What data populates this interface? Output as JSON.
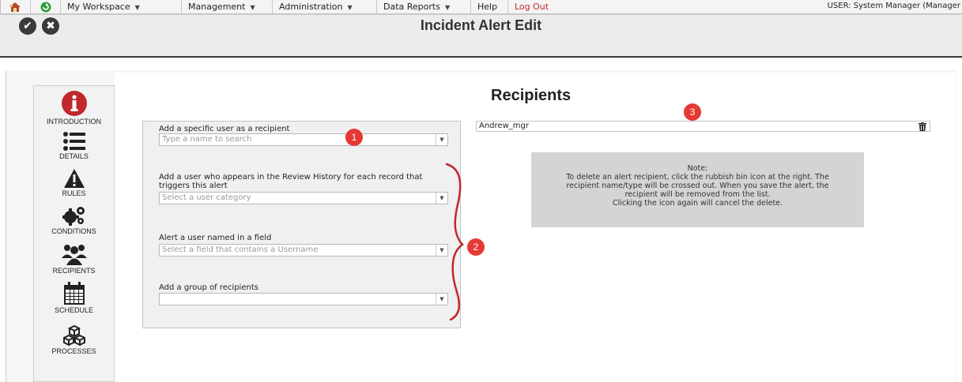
{
  "nav": {
    "items": [
      {
        "label": "My Workspace",
        "dropdown": true
      },
      {
        "label": "Management",
        "dropdown": true
      },
      {
        "label": "Administration",
        "dropdown": true
      },
      {
        "label": "Data Reports",
        "dropdown": true
      },
      {
        "label": "Help",
        "dropdown": false
      },
      {
        "label": "Log Out",
        "dropdown": false
      }
    ],
    "icons": [
      "home-icon",
      "refresh-icon"
    ],
    "caret": "▼",
    "user": "USER: System Manager (Manager"
  },
  "toolbar": {
    "title": "Incident Alert Edit",
    "save_icon": "✔",
    "cancel_icon": "✖"
  },
  "sidebar": {
    "items": [
      {
        "label": "INTRODUCTION",
        "icon": "info-icon"
      },
      {
        "label": "DETAILS",
        "icon": "list-icon"
      },
      {
        "label": "RULES",
        "icon": "warning-icon"
      },
      {
        "label": "CONDITIONS",
        "icon": "gears-icon"
      },
      {
        "label": "RECIPIENTS",
        "icon": "users-icon",
        "active": true
      },
      {
        "label": "SCHEDULE",
        "icon": "calendar-icon"
      },
      {
        "label": "PROCESSES",
        "icon": "cubes-icon"
      }
    ]
  },
  "form": {
    "specific_user": {
      "label": "Add a specific user as a recipient",
      "placeholder": "Type a name to search"
    },
    "review_user": {
      "label": "Add a user who appears in the Review History for each record that triggers this alert",
      "placeholder": "Select a user category"
    },
    "field_user": {
      "label": "Alert a user named in a field",
      "placeholder": "Select a field that contains a Username"
    },
    "group": {
      "label": "Add a group of recipients",
      "placeholder": ""
    }
  },
  "recipients": {
    "title": "Recipients",
    "list": [
      "Andrew_mgr"
    ],
    "note_lines": [
      "Note:",
      "To delete an alert recipient, click the rubbish bin icon at the right. The",
      "recipient name/type will be crossed out. When you save the alert, the",
      "recipient will be removed from the list.",
      "Clicking the icon again will cancel the delete."
    ]
  },
  "callouts": [
    "1",
    "2",
    "3"
  ],
  "colors": {
    "accent": "#c62828",
    "badge": "#e53935",
    "note_bg": "#d4d4d4"
  }
}
